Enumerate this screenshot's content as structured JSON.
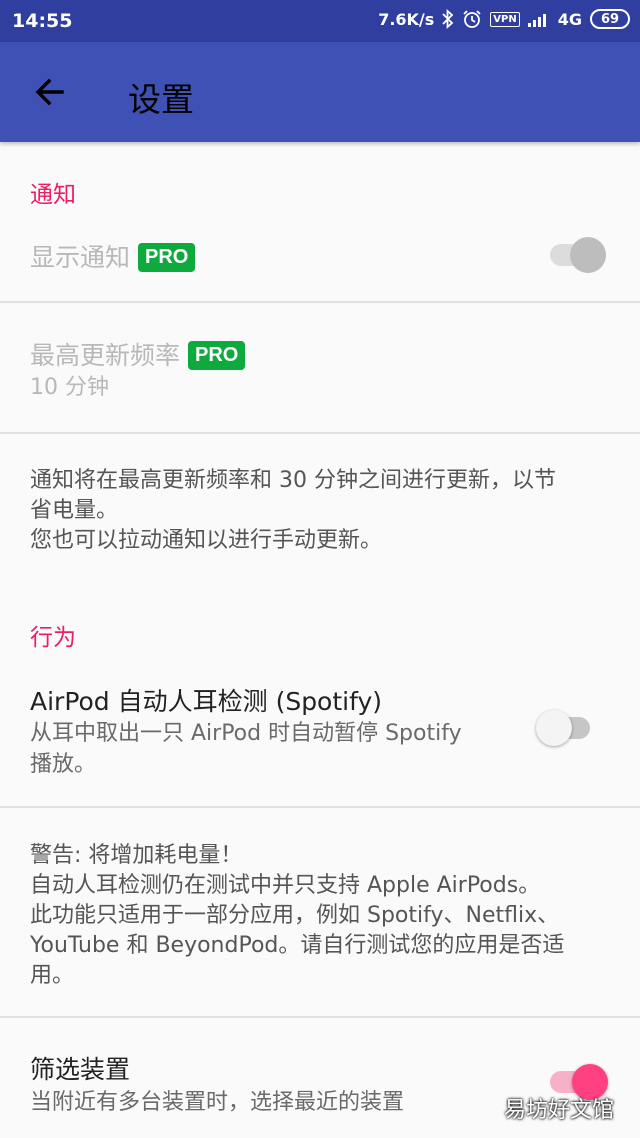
{
  "status_bar": {
    "time": "14:55",
    "net_speed": "7.6K/s",
    "vpn": "VPN",
    "network": "4G",
    "battery": "69",
    "icons": [
      "bluetooth-icon",
      "alarm-icon",
      "vpn-icon",
      "signal-icon",
      "battery-icon"
    ]
  },
  "app_bar": {
    "title": "设置",
    "back_icon": "arrow-left-icon",
    "color": "#3f51b5",
    "status_color": "#303f9f"
  },
  "notification_section": {
    "header": "通知",
    "show_notification": {
      "title": "显示通知",
      "badge": "PRO",
      "enabled": false,
      "checked": true
    },
    "update_frequency": {
      "title": "最高更新频率",
      "badge": "PRO",
      "value": "10 分钟",
      "enabled": false
    },
    "note": "通知将在最高更新频率和 30 分钟之间进行更新，以节\n省电量。\n您也可以拉动通知以进行手动更新。"
  },
  "behavior_section": {
    "header": "行为",
    "airpod_detection": {
      "title": "AirPod 自动人耳检测 (Spotify)",
      "subtitle": "从耳中取出一只 AirPod 时自动暂停 Spotify\n播放。",
      "checked": false
    },
    "warning": "警告: 将增加耗电量！\n自动人耳检测仍在测试中并只支持 Apple AirPods。\n此功能只适用于一部分应用，例如 Spotify、Netflix、\nYouTube 和 BeyondPod。请自行测试您的应用是否适\n用。",
    "filter_devices": {
      "title": "筛选装置",
      "subtitle": "当附近有多台装置时，选择最近的装置",
      "checked": true
    }
  },
  "colors": {
    "accent": "#e91e63",
    "switch_on": "#ff4081",
    "pro_badge": "#0faa3e"
  },
  "watermark": "易坊好文馆"
}
